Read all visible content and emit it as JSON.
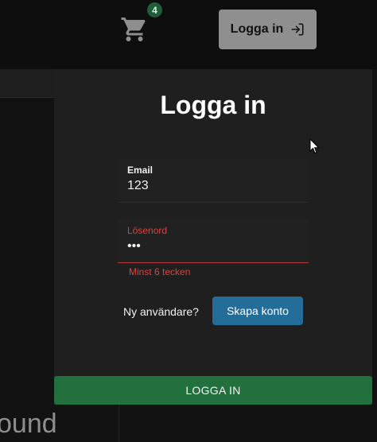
{
  "header": {
    "cart_count": "4",
    "login_label": "Logga in"
  },
  "background": {
    "partial_text": "ound"
  },
  "modal": {
    "title": "Logga in",
    "email": {
      "label": "Email",
      "value": "123"
    },
    "password": {
      "label": "Lösenord",
      "value": "•••",
      "error": "Minst 6 tecken"
    },
    "new_user_text": "Ny användare?",
    "create_account_label": "Skapa konto",
    "submit_label": "LOGGA IN"
  },
  "icons": {
    "cart": "shopping-cart-icon",
    "login": "login-arrow-icon",
    "cursor": "mouse-pointer-icon"
  },
  "colors": {
    "accent_green": "#23703f",
    "accent_blue": "#246d99",
    "error_red": "#d64545",
    "badge_green": "#1f5d38"
  }
}
